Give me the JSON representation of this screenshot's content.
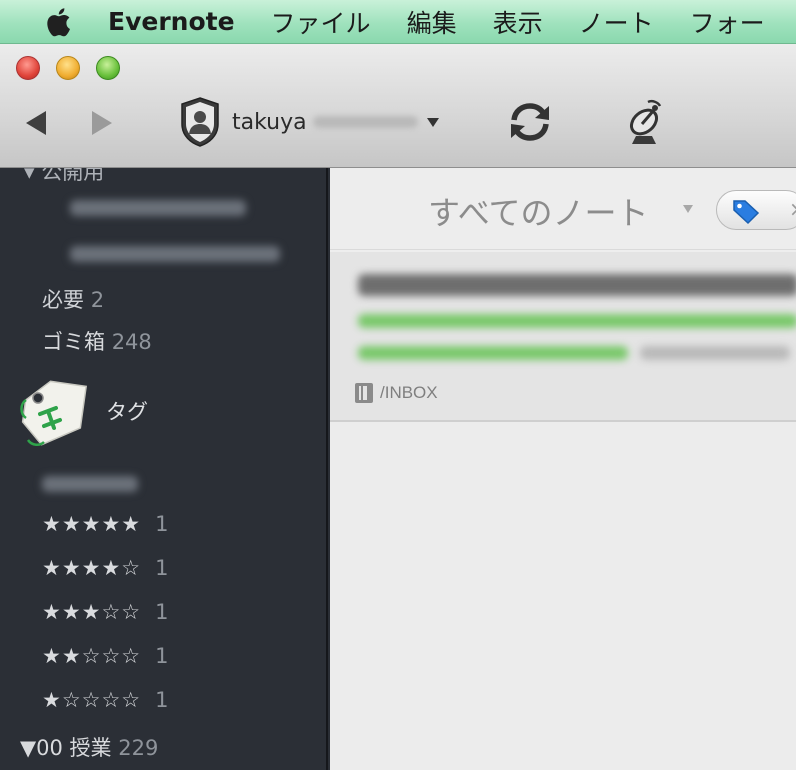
{
  "menubar": {
    "app_name": "Evernote",
    "items": [
      "ファイル",
      "編集",
      "表示",
      "ノート",
      "フォー"
    ]
  },
  "toolbar": {
    "account_name": "takuya"
  },
  "sidebar": {
    "public_section_label": "公開用",
    "required": {
      "label": "必要",
      "count": "2"
    },
    "trash": {
      "label": "ゴミ箱",
      "count": "248"
    },
    "tags_header": "タグ",
    "ratings": [
      {
        "stars": "★★★★★",
        "count": "1"
      },
      {
        "stars": "★★★★☆",
        "count": "1"
      },
      {
        "stars": "★★★☆☆",
        "count": "1"
      },
      {
        "stars": "★★☆☆☆",
        "count": "1"
      },
      {
        "stars": "★☆☆☆☆",
        "count": "1"
      }
    ],
    "class_group": {
      "prefix": "▼",
      "label": "00 授業",
      "count": "229"
    }
  },
  "notelist": {
    "title": "すべてのノート",
    "tag_filter_text": "×",
    "note": {
      "notebook_path": "/INBOX"
    }
  },
  "colors": {
    "menubar": "#9fe2bd",
    "sidebar": "#2b2f36",
    "tag_green": "#2fa34a",
    "tag_blue": "#2a7de1"
  }
}
